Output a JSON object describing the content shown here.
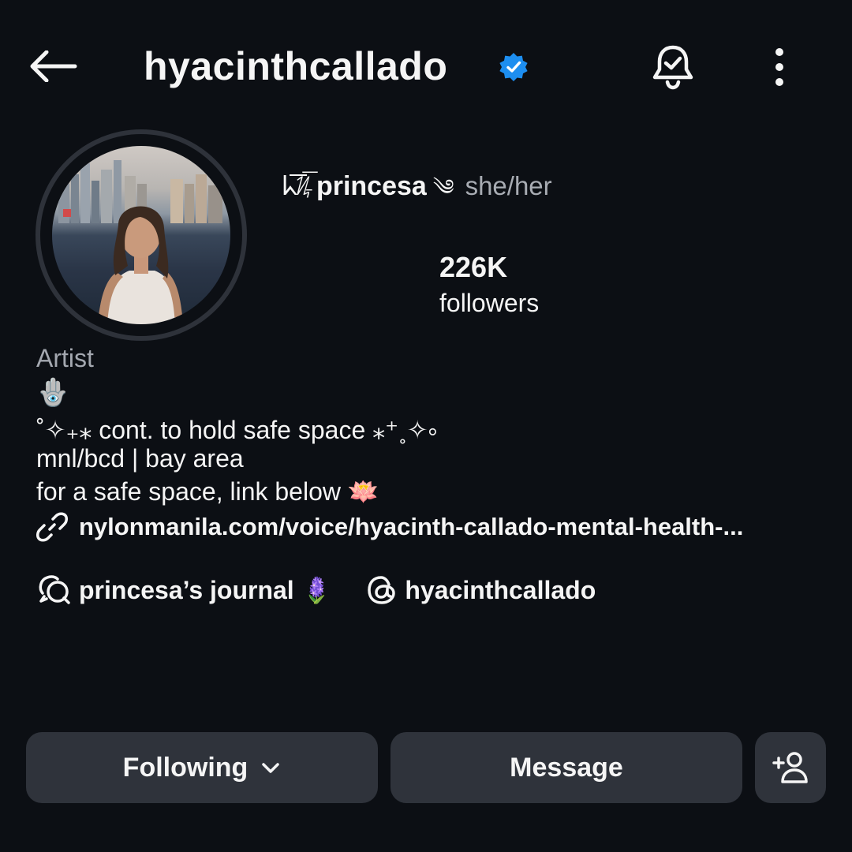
{
  "header": {
    "username": "hyacinthcallado",
    "verified": true,
    "accent": "#0095f6"
  },
  "profile": {
    "name_decoration": "ᖾ͞ᜰ͞ᜳ",
    "display_name": "princesa",
    "name_suffix": "༄",
    "pronouns": "she/her",
    "followers_count": "226K",
    "followers_label": "followers",
    "category": "Artist"
  },
  "bio": {
    "line_emoji": "🪬",
    "line1": "˚✧₊⁎ cont. to hold safe space ⁎⁺˳✧༚",
    "line2": "mnl/bcd | bay area",
    "line3": "for a safe space, link below 🪷",
    "link": "nylonmanila.com/voice/hyacinth-callado-mental-health-..."
  },
  "extras": {
    "channel_label": "princesa’s journal 🪻",
    "threads_label": "hyacinthcallado"
  },
  "actions": {
    "following_label": "Following",
    "message_label": "Message"
  }
}
